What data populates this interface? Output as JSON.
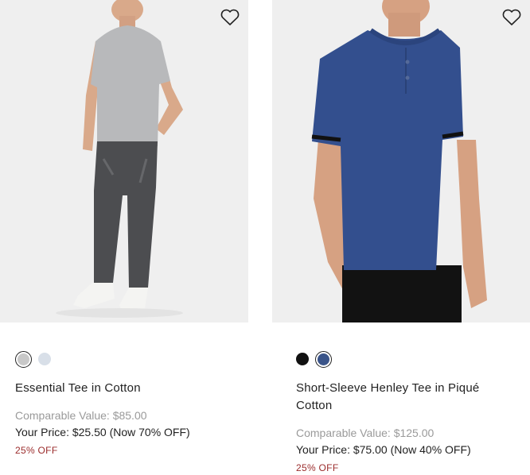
{
  "products": [
    {
      "name": "Essential Tee in Cotton",
      "comparable_value": "Comparable Value: $85.00",
      "your_price": "Your Price: $25.50 (Now 70% OFF)",
      "discount_badge": "25% OFF",
      "swatches": [
        {
          "color": "#c8c8c8",
          "selected": true
        },
        {
          "color": "#d8dfe8",
          "selected": false
        }
      ]
    },
    {
      "name": "Short-Sleeve Henley Tee in Piqué Cotton",
      "comparable_value": "Comparable Value: $125.00",
      "your_price": "Your Price: $75.00 (Now 40% OFF)",
      "discount_badge": "25% OFF",
      "swatches": [
        {
          "color": "#111111",
          "selected": false
        },
        {
          "color": "#3a5489",
          "selected": true
        }
      ]
    }
  ],
  "colors": {
    "discount_red": "#9b2c2c",
    "muted_gray": "#9a9a9a",
    "photo_bg": "#efefef"
  },
  "icons": {
    "wishlist": "heart-icon"
  }
}
